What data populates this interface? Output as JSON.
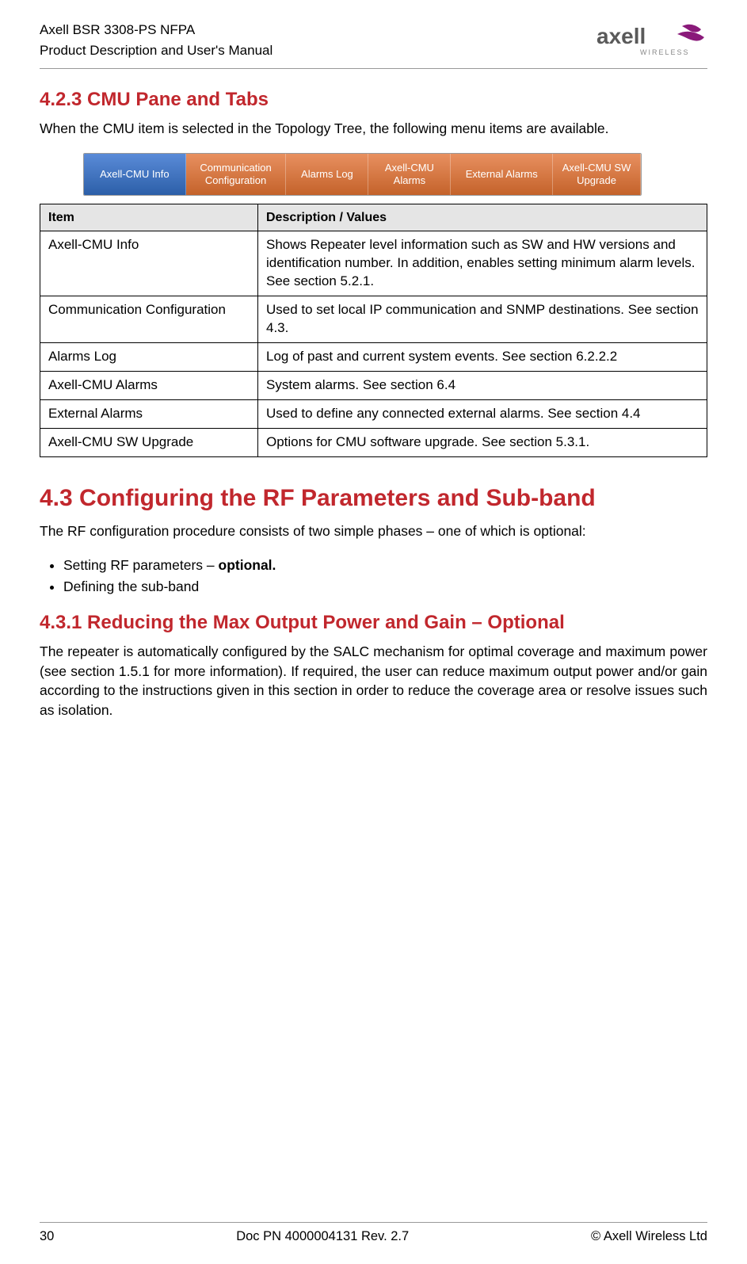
{
  "header": {
    "line1": "Axell BSR 3308-PS NFPA",
    "line2": "Product Description and User's Manual",
    "brand_top": "axell",
    "brand_sub": "WIRELESS"
  },
  "sec_423": {
    "heading": "4.2.3   CMU Pane and Tabs",
    "intro": "When the CMU item is selected in the Topology Tree, the following menu items are available."
  },
  "tabs": {
    "t1": "Axell-CMU Info",
    "t2": "Communication Configuration",
    "t3": "Alarms Log",
    "t4": "Axell-CMU Alarms",
    "t5": "External Alarms",
    "t6": "Axell-CMU SW Upgrade"
  },
  "table": {
    "h1": "Item",
    "h2": "Description / Values",
    "rows": [
      {
        "item": "Axell-CMU Info",
        "desc": "Shows Repeater level information such as SW and HW versions and identification number. In addition, enables setting minimum alarm levels. See section 5.2.1."
      },
      {
        "item": "Communication Configuration",
        "desc": "Used to set local IP communication and SNMP destinations. See section 4.3."
      },
      {
        "item": "Alarms Log",
        "desc": "Log of past and current system events. See section 6.2.2.2"
      },
      {
        "item": "Axell-CMU Alarms",
        "desc": "System alarms. See section 6.4"
      },
      {
        "item": "External Alarms",
        "desc": "Used to define any connected external alarms. See section 4.4"
      },
      {
        "item": "Axell-CMU SW Upgrade",
        "desc": "Options for CMU software upgrade. See section 5.3.1."
      }
    ]
  },
  "sec_43": {
    "heading": "4.3   Configuring the RF Parameters and Sub-band",
    "intro": "The RF configuration procedure consists of two simple phases – one of which is optional:",
    "bullet1_pre": "Setting RF parameters – ",
    "bullet1_bold": "optional.",
    "bullet2": " Defining the sub-band"
  },
  "sec_431": {
    "heading": "4.3.1   Reducing the Max Output Power and Gain – Optional",
    "body": "The repeater is automatically configured by the SALC mechanism for optimal coverage and maximum power (see section 1.5.1 for more information). If required, the user can reduce maximum output power and/or gain according to the instructions given in this section in order to reduce the coverage area or resolve issues such as isolation."
  },
  "footer": {
    "left": "30",
    "center": "Doc PN 4000004131 Rev. 2.7",
    "right": "© Axell Wireless Ltd"
  }
}
